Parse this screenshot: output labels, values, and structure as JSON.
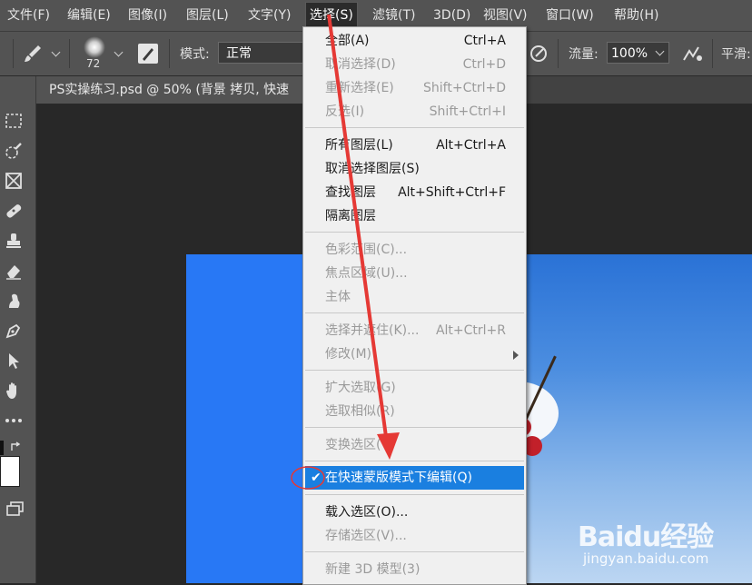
{
  "menubar": {
    "items": [
      "文件(F)",
      "编辑(E)",
      "图像(I)",
      "图层(L)",
      "文字(Y)",
      "选择(S)",
      "滤镜(T)",
      "3D(D)",
      "视图(V)",
      "窗口(W)",
      "帮助(H)"
    ]
  },
  "options": {
    "brush_size": "72",
    "mode_label": "模式:",
    "mode_value": "正常",
    "flow_label": "流量:",
    "flow_value": "100%",
    "smooth_label": "平滑:"
  },
  "document_tab": {
    "title": "PS实操练习.psd @ 50% (背景 拷贝, 快速"
  },
  "select_menu": {
    "items": [
      {
        "label": "全部(A)",
        "shortcut": "Ctrl+A"
      },
      {
        "label": "取消选择(D)",
        "shortcut": "Ctrl+D"
      },
      {
        "label": "重新选择(E)",
        "shortcut": "Shift+Ctrl+D"
      },
      {
        "label": "反选(I)",
        "shortcut": "Shift+Ctrl+I"
      },
      {
        "label": "所有图层(L)",
        "shortcut": "Alt+Ctrl+A"
      },
      {
        "label": "取消选择图层(S)",
        "shortcut": ""
      },
      {
        "label": "查找图层",
        "shortcut": "Alt+Shift+Ctrl+F"
      },
      {
        "label": "隔离图层",
        "shortcut": ""
      },
      {
        "label": "色彩范围(C)...",
        "shortcut": ""
      },
      {
        "label": "焦点区域(U)...",
        "shortcut": ""
      },
      {
        "label": "主体",
        "shortcut": ""
      },
      {
        "label": "选择并遮住(K)...",
        "shortcut": "Alt+Ctrl+R"
      },
      {
        "label": "修改(M)",
        "shortcut": ""
      },
      {
        "label": "扩大选取(G)",
        "shortcut": ""
      },
      {
        "label": "选取相似(R)",
        "shortcut": ""
      },
      {
        "label": "变换选区(T)",
        "shortcut": ""
      },
      {
        "label": "在快速蒙版模式下编辑(Q)",
        "shortcut": ""
      },
      {
        "label": "载入选区(O)...",
        "shortcut": ""
      },
      {
        "label": "存储选区(V)...",
        "shortcut": ""
      },
      {
        "label": "新建 3D 模型(3)",
        "shortcut": ""
      }
    ],
    "checked_item": "在快速蒙版模式下编辑(Q)"
  },
  "watermark": {
    "brand": "Baidu经验",
    "url": "jingyan.baidu.com"
  },
  "colors": {
    "highlight": "#1a7fe0",
    "annotation_red": "#e53935",
    "canvas_blue": "#2878f5"
  }
}
